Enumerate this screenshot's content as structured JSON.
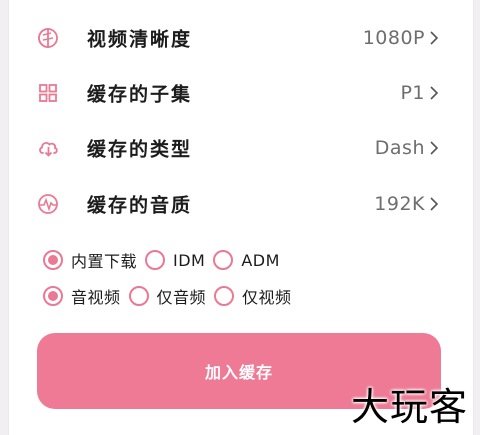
{
  "accent_color": "#ea7994",
  "settings": [
    {
      "icon": "resolution-icon",
      "label": "视频清晰度",
      "value": "1080P"
    },
    {
      "icon": "grid-icon",
      "label": "缓存的子集",
      "value": "P1"
    },
    {
      "icon": "cloud-download-icon",
      "label": "缓存的类型",
      "value": "Dash"
    },
    {
      "icon": "audio-wave-icon",
      "label": "缓存的音质",
      "value": "192K"
    }
  ],
  "downloader_options": [
    {
      "label": "内置下载",
      "selected": true
    },
    {
      "label": "IDM",
      "selected": false
    },
    {
      "label": "ADM",
      "selected": false
    }
  ],
  "content_options": [
    {
      "label": "音视频",
      "selected": true
    },
    {
      "label": "仅音频",
      "selected": false
    },
    {
      "label": "仅视频",
      "selected": false
    }
  ],
  "add_button_label": "加入缓存",
  "watermark": "大玩客"
}
